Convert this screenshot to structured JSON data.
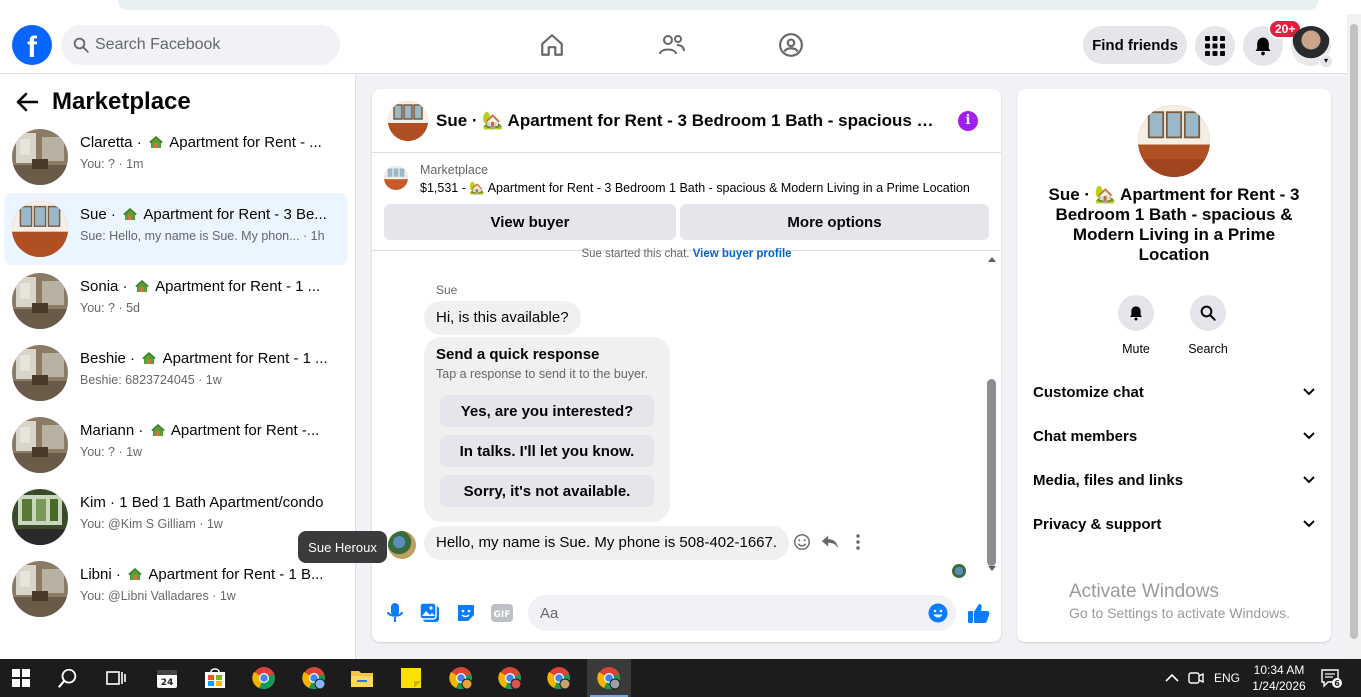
{
  "topbar": {
    "logo_letter": "f",
    "search_placeholder": "Search Facebook",
    "find_friends_label": "Find friends",
    "notif_badge": "20+"
  },
  "sidebar": {
    "title": "Marketplace",
    "conversations": [
      {
        "name": "Claretta",
        "listing": "Apartment for Rent - ...",
        "sub": "You: ? · 1m",
        "active": false
      },
      {
        "name": "Sue",
        "listing": "Apartment for Rent - 3 Be...",
        "sub": "Sue: Hello, my name is Sue. My phon... · 1h",
        "active": true
      },
      {
        "name": "Sonia",
        "listing": "Apartment for Rent - 1 ...",
        "sub": "You: ? · 5d",
        "active": false
      },
      {
        "name": "Beshie",
        "listing": "Apartment for Rent - 1 ...",
        "sub": "Beshie: 6823724045 · 1w",
        "active": false
      },
      {
        "name": "Mariann",
        "listing": "Apartment for Rent -...",
        "sub": "You: ? · 1w",
        "active": false
      },
      {
        "name": "Kim",
        "listing": "1 Bed 1 Bath Apartment/condo",
        "sub": "You: @Kim S Gilliam · 1w",
        "active": false
      },
      {
        "name": "Libni",
        "listing": "Apartment for Rent - 1 B...",
        "sub": "You: @Libni Valladares · 1w",
        "active": false
      }
    ],
    "tooltip": "Sue Heroux"
  },
  "chat": {
    "header_title": "Sue · 🏡 Apartment for Rent - 3 Bedroom 1 Bath - spacious & Modern Living in a Prime Location",
    "listing_source": "Marketplace",
    "listing_line": "$1,531 - 🏡 Apartment for Rent - 3 Bedroom 1 Bath - spacious & Modern Living in a Prime Location",
    "view_buyer": "View buyer",
    "more_options": "More options",
    "started_text": "Sue started this chat.",
    "view_buyer_profile": "View buyer profile",
    "sender_name": "Sue",
    "msg1": "Hi, is this available?",
    "quick_title": "Send a quick response",
    "quick_sub": "Tap a response to send it to the buyer.",
    "quick_responses": [
      "Yes, are you interested?",
      "In talks. I'll let you know.",
      "Sorry, it's not available."
    ],
    "msg2": "Hello, my name is Sue. My phone is 508-402-1667.",
    "composer_placeholder": "Aa"
  },
  "rpanel": {
    "title": "Sue · 🏡 Apartment for Rent - 3 Bedroom 1 Bath - spacious & Modern Living in a Prime Location",
    "mute_label": "Mute",
    "search_label": "Search",
    "rows": [
      "Customize chat",
      "Chat members",
      "Media, files and links",
      "Privacy & support"
    ]
  },
  "watermark": {
    "line1": "Activate Windows",
    "line2": "Go to Settings to activate Windows."
  },
  "taskbar": {
    "lang": "ENG",
    "time": "10:34 AM",
    "date": "1/24/2026",
    "notif_count": "6"
  },
  "colors": {
    "brand": "#0866ff",
    "messenger_accent": "#0a7cff",
    "info": "#a020f0",
    "badge": "#e41e3f"
  }
}
